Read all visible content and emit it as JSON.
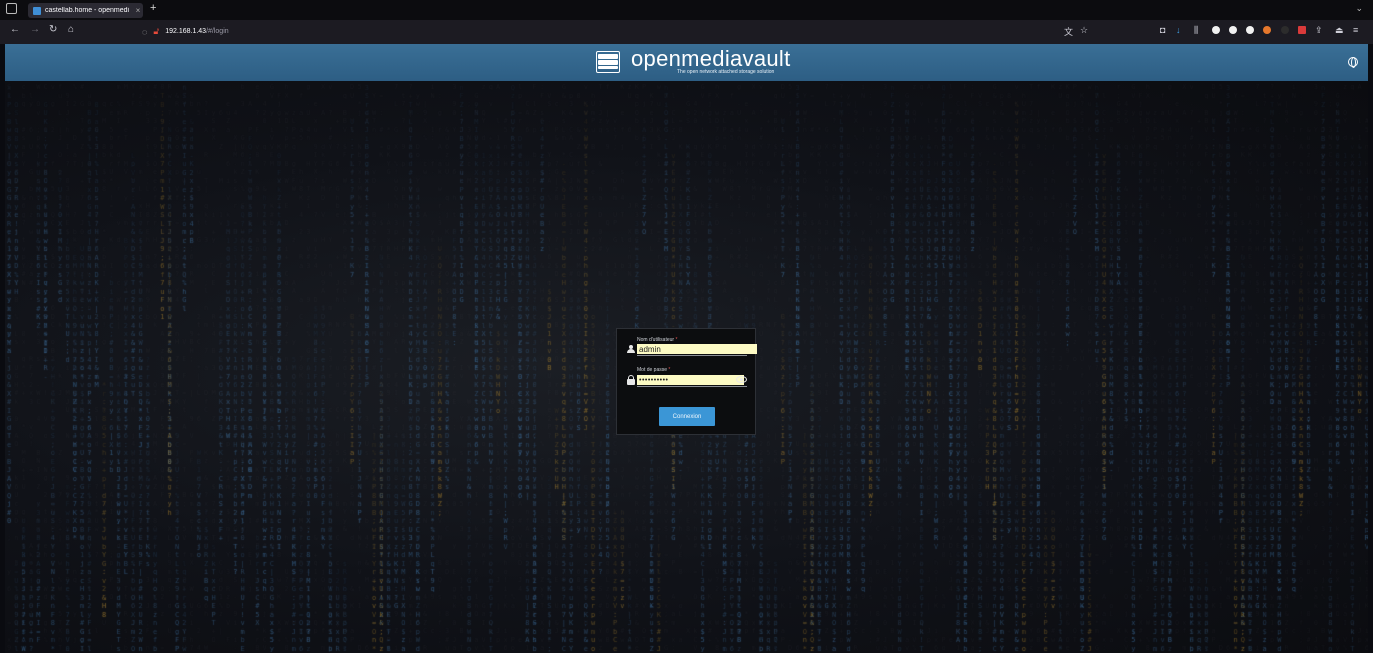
{
  "browser": {
    "tab_title": "castellab.home - openmedi",
    "tab_close": "×",
    "new_tab": "+",
    "url_host": "192.168.1.43",
    "url_path": "/#/login"
  },
  "header": {
    "app_name": "openmediavault",
    "tagline": "The open network attached storage solution"
  },
  "login": {
    "username_label": "Nom d'utilisateur",
    "username_value": "admin",
    "password_label": "Mot de passe",
    "password_value": "••••••••••",
    "required_mark": "*",
    "submit_label": "Connexion"
  },
  "colors": {
    "header_bg": "#2d5e84",
    "button_bg": "#3b96d6",
    "input_bg": "#fdfbc4",
    "matrix_blue": "#3d6f9e",
    "matrix_gold": "#b58b2e"
  }
}
